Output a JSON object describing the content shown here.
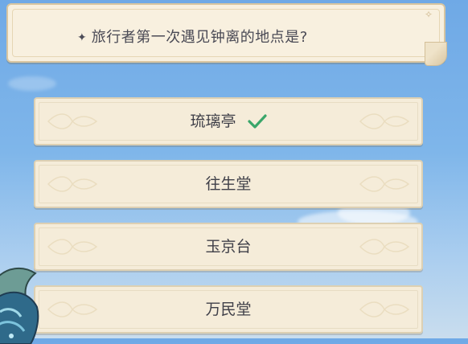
{
  "question": {
    "text": "旅行者第一次遇见钟离的地点是?"
  },
  "answers": [
    {
      "label": "琉璃亭",
      "selected": true
    },
    {
      "label": "往生堂",
      "selected": false
    },
    {
      "label": "玉京台",
      "selected": false
    },
    {
      "label": "万民堂",
      "selected": false
    }
  ],
  "icons": {
    "question_marker": "four-point-star-icon",
    "correct_marker": "checkmark-icon"
  },
  "colors": {
    "check": "#3aa66a",
    "panel": "#f8f0df",
    "text": "#4a4a55"
  }
}
